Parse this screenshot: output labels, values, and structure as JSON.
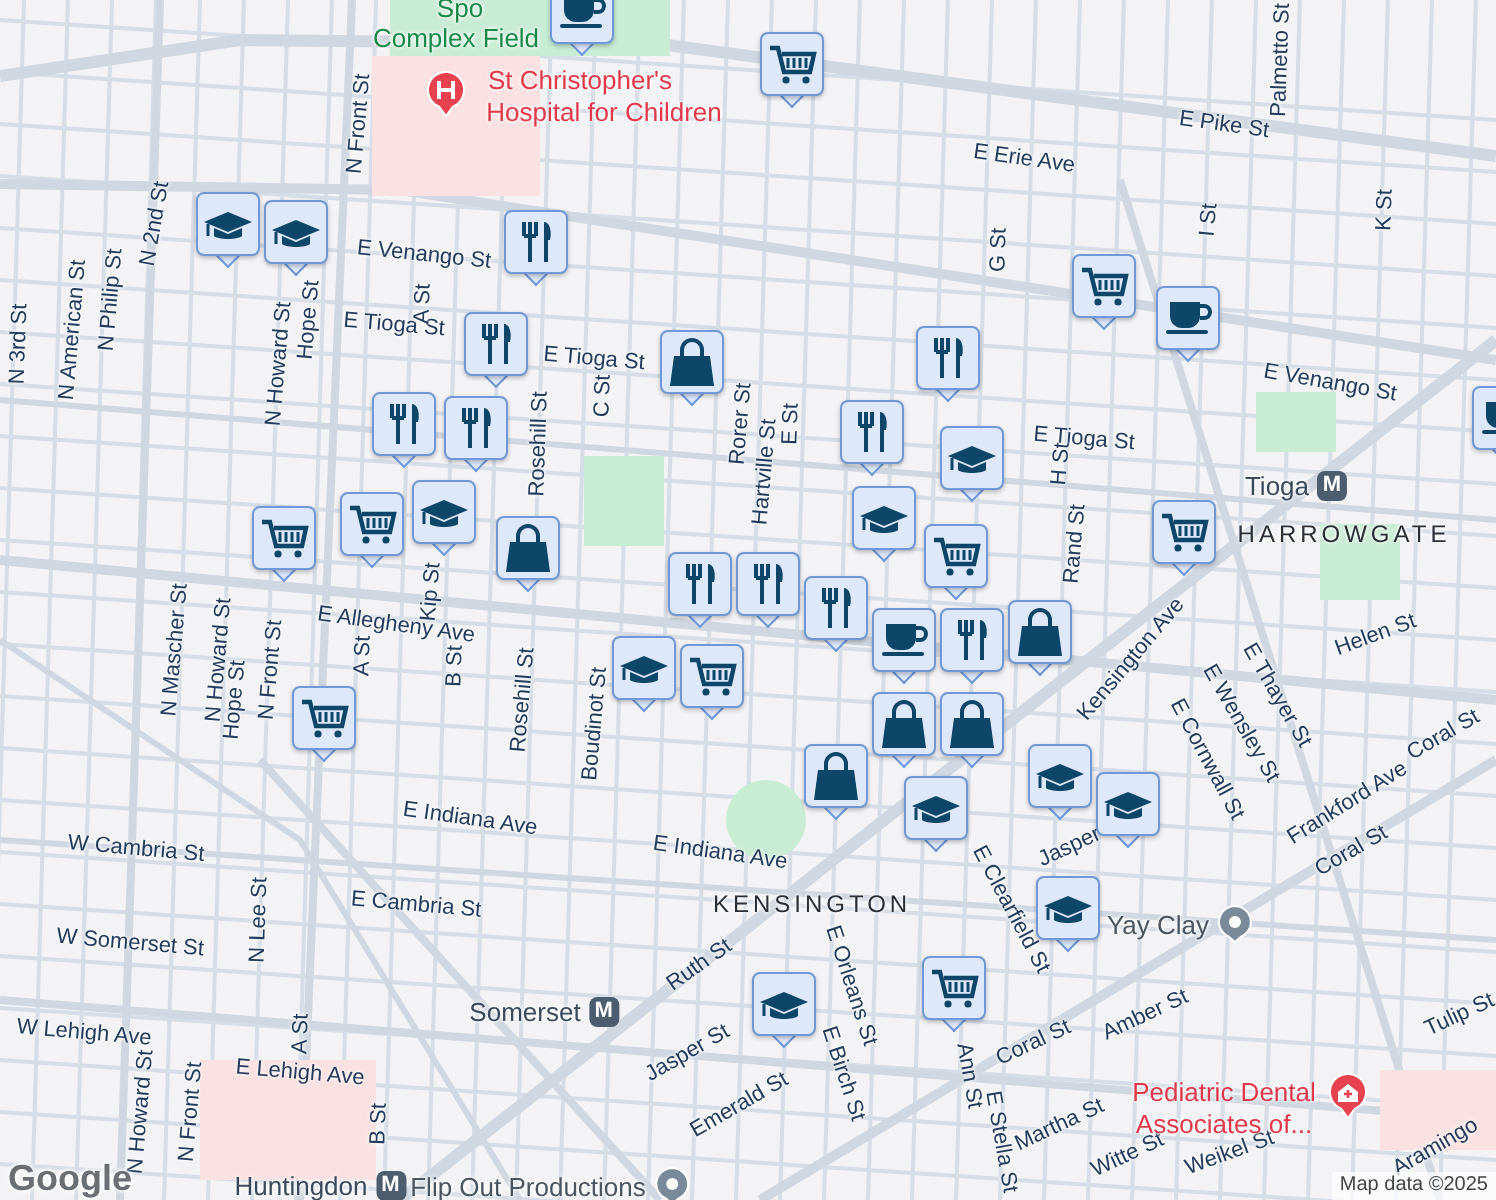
{
  "map": {
    "labels": [
      {
        "text": "Spo",
        "kind": "park"
      },
      {
        "text": "Complex Field",
        "kind": "park"
      },
      {
        "text": "St Christopher's",
        "kind": "medical"
      },
      {
        "text": "Hospital for Children",
        "kind": "medical"
      },
      {
        "text": "N Front St",
        "kind": "street"
      },
      {
        "text": "N 2nd St",
        "kind": "street"
      },
      {
        "text": "E Erie Ave",
        "kind": "street"
      },
      {
        "text": "E Pike St",
        "kind": "street"
      },
      {
        "text": "Palmetto St",
        "kind": "street"
      },
      {
        "text": "G St",
        "kind": "street"
      },
      {
        "text": "I St",
        "kind": "street"
      },
      {
        "text": "K St",
        "kind": "street"
      },
      {
        "text": "E Venango St",
        "kind": "street"
      },
      {
        "text": "E Venango St",
        "kind": "street"
      },
      {
        "text": "E Tioga St",
        "kind": "street"
      },
      {
        "text": "E Tioga St",
        "kind": "street"
      },
      {
        "text": "E Tioga St",
        "kind": "street"
      },
      {
        "text": "N 3rd St",
        "kind": "street"
      },
      {
        "text": "N American St",
        "kind": "street"
      },
      {
        "text": "N Philip St",
        "kind": "street"
      },
      {
        "text": "N Howard St",
        "kind": "street"
      },
      {
        "text": "Hope St",
        "kind": "street"
      },
      {
        "text": "A St",
        "kind": "street"
      },
      {
        "text": "Rorer St",
        "kind": "street"
      },
      {
        "text": "Hartville St",
        "kind": "street"
      },
      {
        "text": "E St",
        "kind": "street"
      },
      {
        "text": "C St",
        "kind": "street"
      },
      {
        "text": "Rosehill St",
        "kind": "street"
      },
      {
        "text": "H St",
        "kind": "street"
      },
      {
        "text": "Rand St",
        "kind": "street"
      },
      {
        "text": "Tioga",
        "kind": "transit",
        "badge": "M"
      },
      {
        "text": "HARROWGATE",
        "kind": "district"
      },
      {
        "text": "E Allegheny Ave",
        "kind": "street"
      },
      {
        "text": "N Mascher St",
        "kind": "street"
      },
      {
        "text": "N Howard St",
        "kind": "street"
      },
      {
        "text": "Hope St",
        "kind": "street"
      },
      {
        "text": "N Front St",
        "kind": "street"
      },
      {
        "text": "A St",
        "kind": "street"
      },
      {
        "text": "B St",
        "kind": "street"
      },
      {
        "text": "Kip St",
        "kind": "street"
      },
      {
        "text": "Rosehill St",
        "kind": "street"
      },
      {
        "text": "Boudinot St",
        "kind": "street"
      },
      {
        "text": "Kensington Ave",
        "kind": "street"
      },
      {
        "text": "E Thayer St",
        "kind": "street"
      },
      {
        "text": "E Wensley St",
        "kind": "street"
      },
      {
        "text": "E Cornwall St",
        "kind": "street"
      },
      {
        "text": "Helen St",
        "kind": "street"
      },
      {
        "text": "Frankford Ave",
        "kind": "street"
      },
      {
        "text": "Coral St",
        "kind": "street"
      },
      {
        "text": "Coral St",
        "kind": "street"
      },
      {
        "text": "E Indiana Ave",
        "kind": "street"
      },
      {
        "text": "E Indiana Ave",
        "kind": "street"
      },
      {
        "text": "W Cambria St",
        "kind": "street"
      },
      {
        "text": "E Cambria St",
        "kind": "street"
      },
      {
        "text": "W Somerset St",
        "kind": "street"
      },
      {
        "text": "N Lee St",
        "kind": "street"
      },
      {
        "text": "Somerset",
        "kind": "transit",
        "badge": "M"
      },
      {
        "text": "W Lehigh Ave",
        "kind": "street"
      },
      {
        "text": "E Lehigh Ave",
        "kind": "street"
      },
      {
        "text": "A St",
        "kind": "street"
      },
      {
        "text": "B St",
        "kind": "street"
      },
      {
        "text": "N Howard St",
        "kind": "street"
      },
      {
        "text": "N Front St",
        "kind": "street"
      },
      {
        "text": "Huntingdon",
        "kind": "transit",
        "badge": "M"
      },
      {
        "text": "Flip Out Productions",
        "kind": "place"
      },
      {
        "text": "Ruth St",
        "kind": "street"
      },
      {
        "text": "Jasper St",
        "kind": "street"
      },
      {
        "text": "Emerald St",
        "kind": "street"
      },
      {
        "text": "E Orleans St",
        "kind": "street"
      },
      {
        "text": "E Birch St",
        "kind": "street"
      },
      {
        "text": "Ann St",
        "kind": "street"
      },
      {
        "text": "E Stella St",
        "kind": "street"
      },
      {
        "text": "Coral St",
        "kind": "street"
      },
      {
        "text": "Amber St",
        "kind": "street"
      },
      {
        "text": "Martha St",
        "kind": "street"
      },
      {
        "text": "Witte St",
        "kind": "street"
      },
      {
        "text": "Weikel St",
        "kind": "street"
      },
      {
        "text": "E Clearfield St",
        "kind": "street"
      },
      {
        "text": "Jasper",
        "kind": "street"
      },
      {
        "text": "KENSINGTON",
        "kind": "district"
      },
      {
        "text": "Yay Clay",
        "kind": "place"
      },
      {
        "text": "Pediatric Dental",
        "kind": "medical"
      },
      {
        "text": "Associates of...",
        "kind": "medical"
      },
      {
        "text": "Tulip St",
        "kind": "street"
      },
      {
        "text": "Aramingo",
        "kind": "street"
      }
    ],
    "pins": [
      {
        "kind": "coffee"
      },
      {
        "kind": "cart"
      },
      {
        "kind": "school"
      },
      {
        "kind": "school"
      },
      {
        "kind": "food"
      },
      {
        "kind": "food"
      },
      {
        "kind": "bag"
      },
      {
        "kind": "food"
      },
      {
        "kind": "cart"
      },
      {
        "kind": "coffee"
      },
      {
        "kind": "food"
      },
      {
        "kind": "school"
      },
      {
        "kind": "food"
      },
      {
        "kind": "food"
      },
      {
        "kind": "school"
      },
      {
        "kind": "cart"
      },
      {
        "kind": "cart"
      },
      {
        "kind": "bag"
      },
      {
        "kind": "school"
      },
      {
        "kind": "cart"
      },
      {
        "kind": "cart"
      },
      {
        "kind": "food"
      },
      {
        "kind": "food"
      },
      {
        "kind": "food"
      },
      {
        "kind": "school"
      },
      {
        "kind": "cart"
      },
      {
        "kind": "coffee"
      },
      {
        "kind": "food"
      },
      {
        "kind": "bag"
      },
      {
        "kind": "bag"
      },
      {
        "kind": "bag"
      },
      {
        "kind": "bag"
      },
      {
        "kind": "cart"
      },
      {
        "kind": "school"
      },
      {
        "kind": "school"
      },
      {
        "kind": "school"
      },
      {
        "kind": "school"
      },
      {
        "kind": "school"
      },
      {
        "kind": "cart"
      },
      {
        "kind": "coffee"
      }
    ],
    "logo": "Google",
    "attribution": "Map data ©2025"
  }
}
